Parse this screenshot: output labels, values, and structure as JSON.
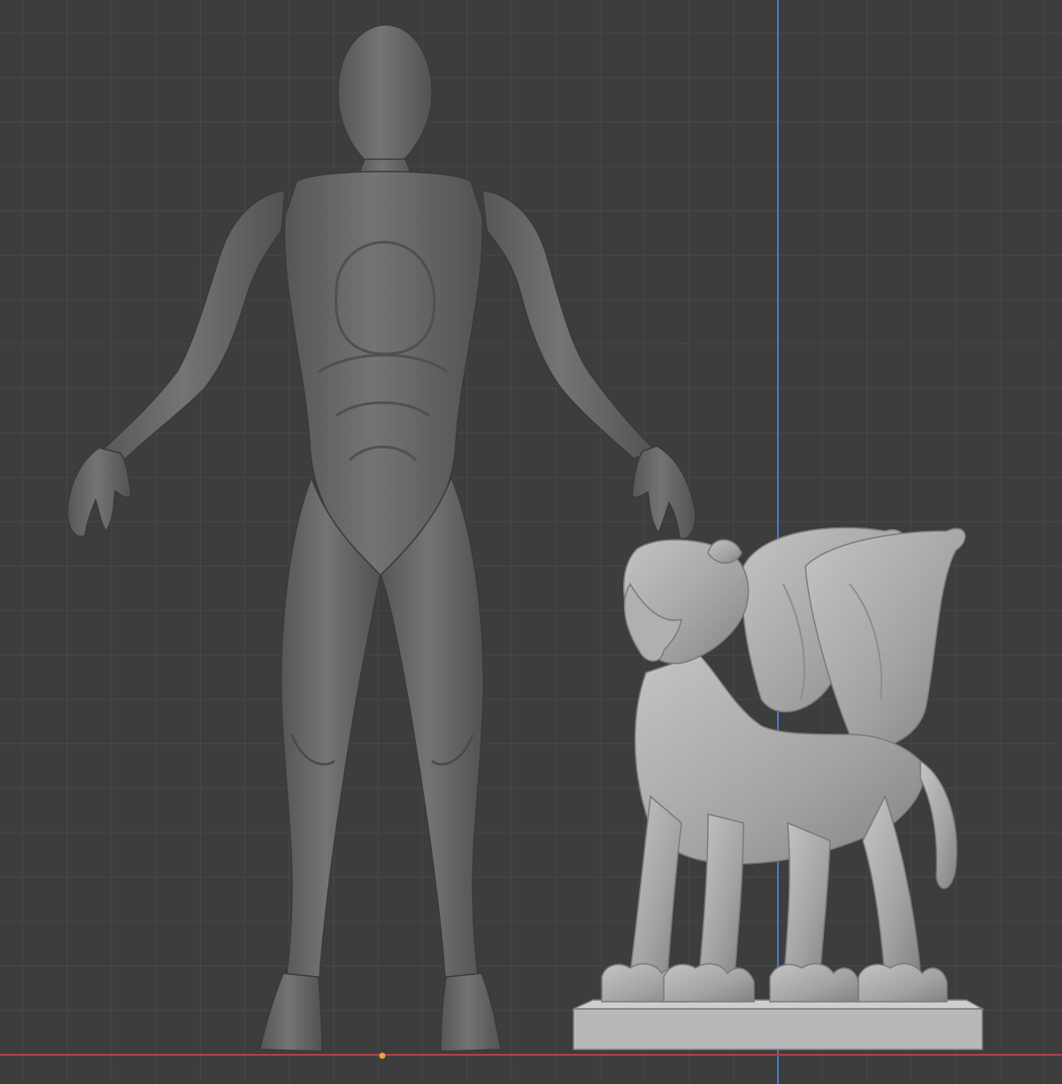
{
  "viewport": {
    "mode": "orthographic-front-view",
    "grid": true,
    "axes": {
      "vertical_axis_color": "#4d79c9",
      "horizontal_axis_color": "#b3414b",
      "origin_marker_color": "#e8a23a"
    },
    "colors": {
      "background": "#3d3d3d",
      "grid_minor": "#484848",
      "grid_major": "#2c2c2c",
      "figure_mesh": "#6b6b6b",
      "griffin_mesh": "#a9a9a9"
    }
  },
  "objects": [
    {
      "name": "humanoid-figure",
      "kind": "sculpt-mesh",
      "selected": false
    },
    {
      "name": "griffin-statue",
      "kind": "sculpt-mesh",
      "selected": false
    }
  ]
}
